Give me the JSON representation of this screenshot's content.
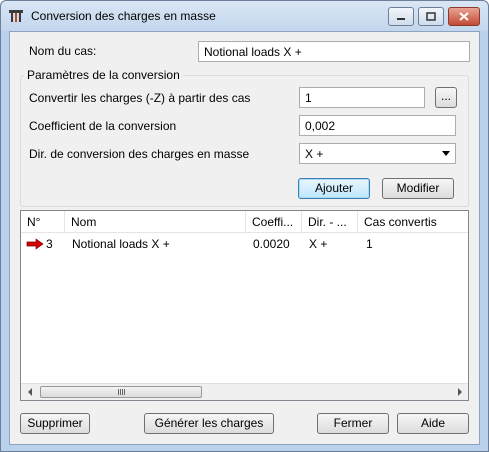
{
  "window": {
    "title": "Conversion des charges en masse",
    "icon": "beam-icon"
  },
  "form": {
    "case_name_label": "Nom du cas:",
    "case_name_value": "Notional loads X +",
    "group_title": "Paramètres de la conversion",
    "convert_label": "Convertir les charges (-Z) à partir des cas",
    "convert_value": "1",
    "browse_label": "...",
    "coef_label": "Coefficient de la conversion",
    "coef_value": "0,002",
    "dir_label": "Dir. de conversion des charges en masse",
    "dir_value": "X +"
  },
  "actions": {
    "add_label": "Ajouter",
    "modify_label": "Modifier"
  },
  "table": {
    "columns": [
      "N°",
      "Nom",
      "Coeffi...",
      "Dir. - ...",
      "Cas convertis"
    ],
    "rows": [
      {
        "num": "3",
        "name": "Notional loads X +",
        "coef": "0.0020",
        "dir": "X +",
        "cases": "1"
      }
    ]
  },
  "footer": {
    "delete_label": "Supprimer",
    "generate_label": "Générer les charges",
    "close_label": "Fermer",
    "help_label": "Aide"
  },
  "colors": {
    "accent_arrow": "#d40000",
    "title_gradient": "#c3d6ed"
  }
}
